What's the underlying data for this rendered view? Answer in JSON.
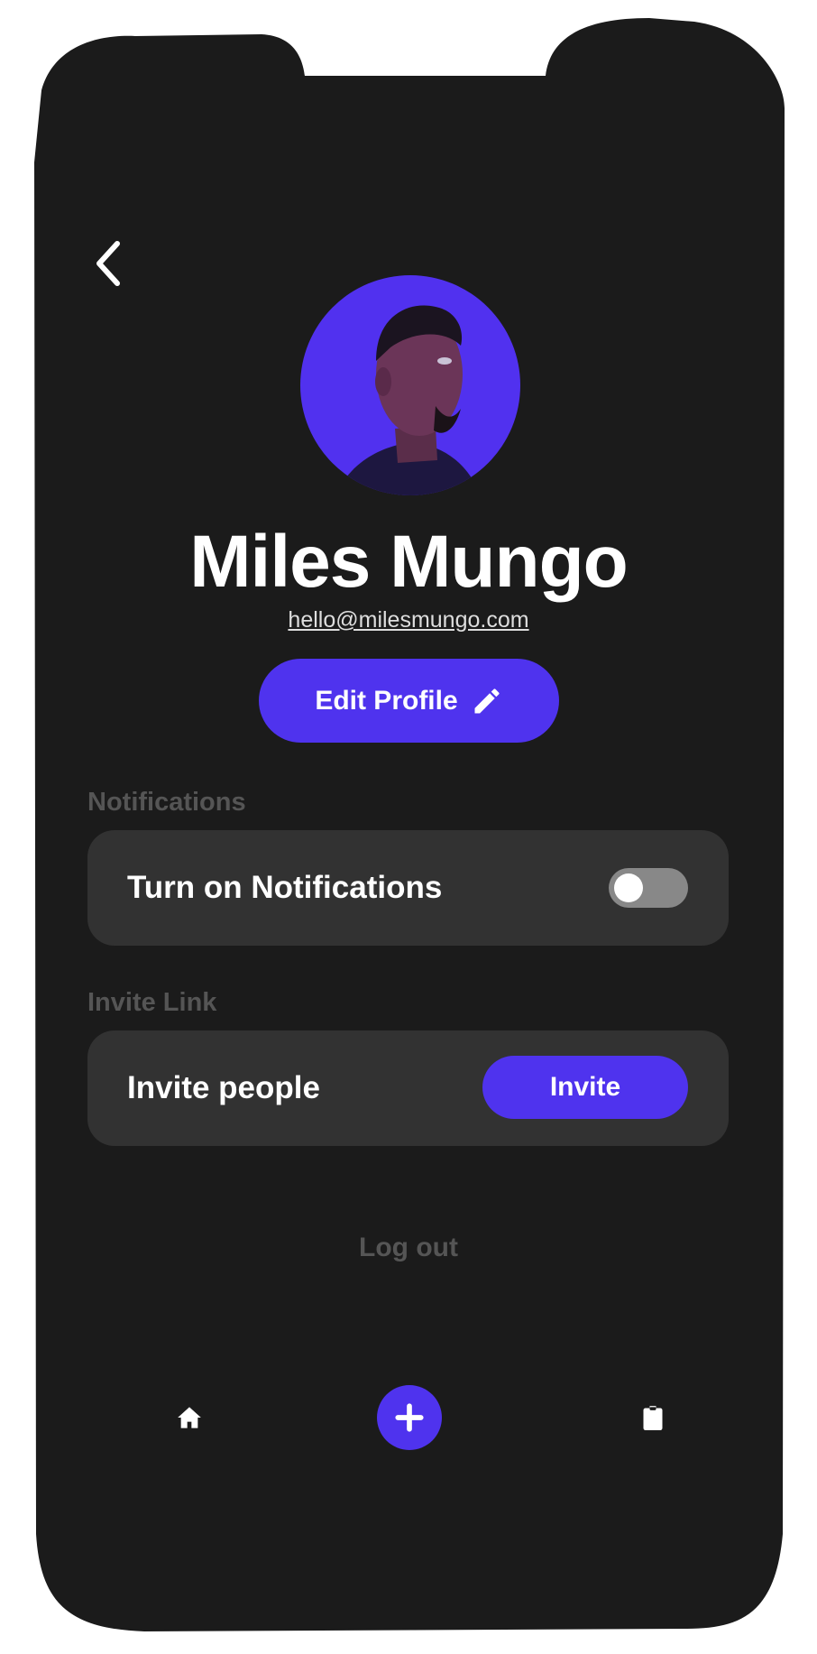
{
  "colors": {
    "background": "#1b1b1b",
    "card": "#323232",
    "accent": "#4f33ee",
    "muted": "#555555"
  },
  "header": {
    "back_icon": "chevron-left-icon"
  },
  "profile": {
    "name": "Miles Mungo",
    "email": "hello@milesmungo.com",
    "edit_label": "Edit Profile",
    "edit_icon": "pencil-icon"
  },
  "notifications": {
    "section_label": "Notifications",
    "item_label": "Turn on Notifications",
    "enabled": false
  },
  "invite": {
    "section_label": "Invite Link",
    "item_label": "Invite people",
    "button_label": "Invite"
  },
  "logout_label": "Log out",
  "bottom_nav": {
    "items": [
      {
        "icon": "home-icon"
      },
      {
        "icon": "plus-icon"
      },
      {
        "icon": "clipboard-icon"
      }
    ]
  }
}
